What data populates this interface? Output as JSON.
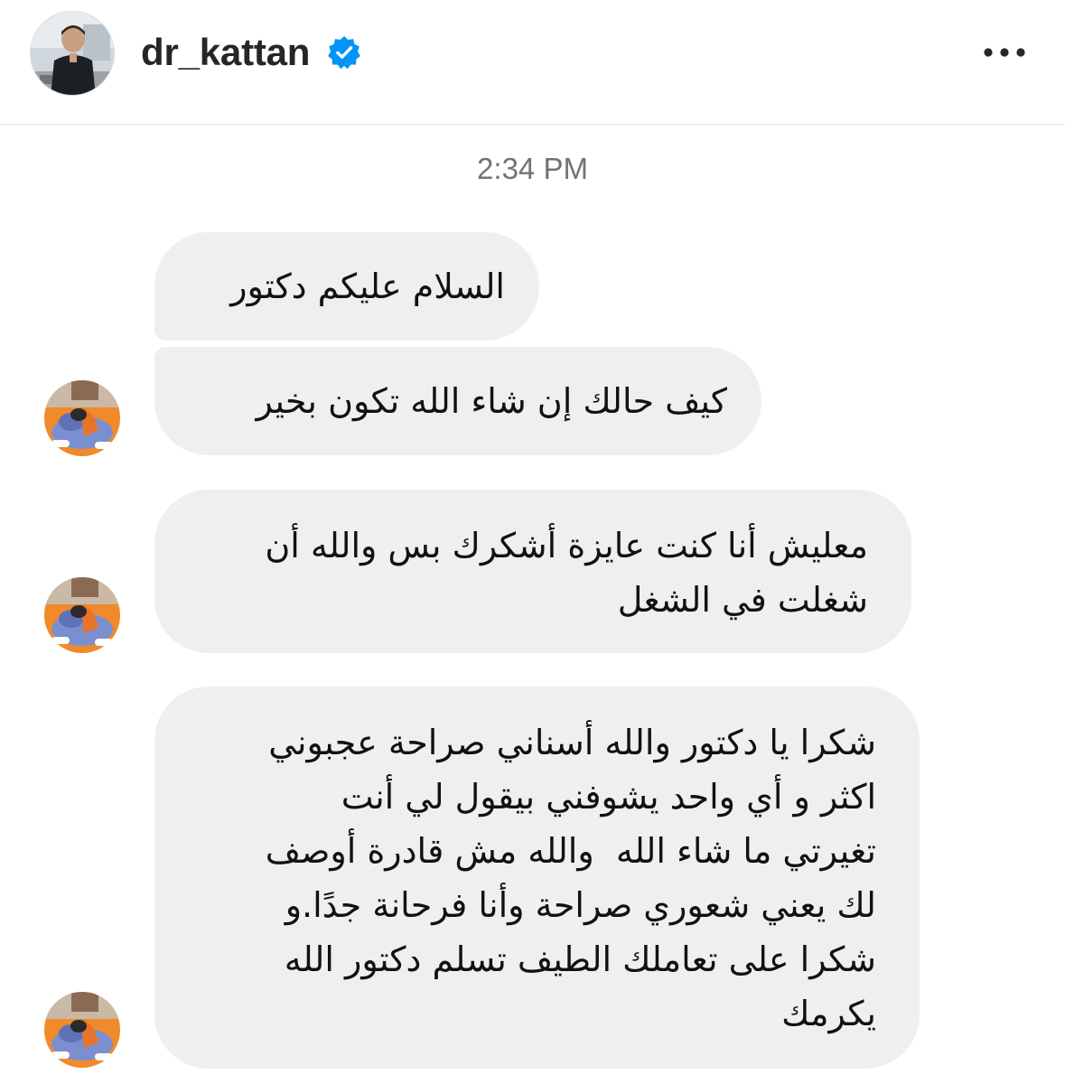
{
  "header": {
    "username": "dr_kattan",
    "verified": true,
    "avatar_icon": "profile-photo-icon",
    "more_icon": "more-options-icon"
  },
  "thread": {
    "timestamp": "2:34 PM",
    "messages": [
      {
        "text": "السلام عليكم دكتور"
      },
      {
        "text": "كيف حالك إن شاء الله تكون بخير"
      },
      {
        "text": "معليش أنا كنت عايزة أشكرك بس والله أن\nشغلت في الشغل"
      },
      {
        "text": "شكرا يا دكتور والله أسناني صراحة عجبوني\nاكثر و أي واحد يشوفني بيقول لي أنت\nتغيرتي ما شاء الله  والله مش قادرة أوصف\nلك يعني شعوري صراحة وأنا فرحانة جدًا.و\nشكرا على تعاملك الطيف تسلم دكتور الله\nيكرمك"
      }
    ]
  },
  "colors": {
    "bubble_bg": "#efefef",
    "verified_blue": "#0095f6",
    "text": "#262626",
    "timestamp": "#737373"
  }
}
